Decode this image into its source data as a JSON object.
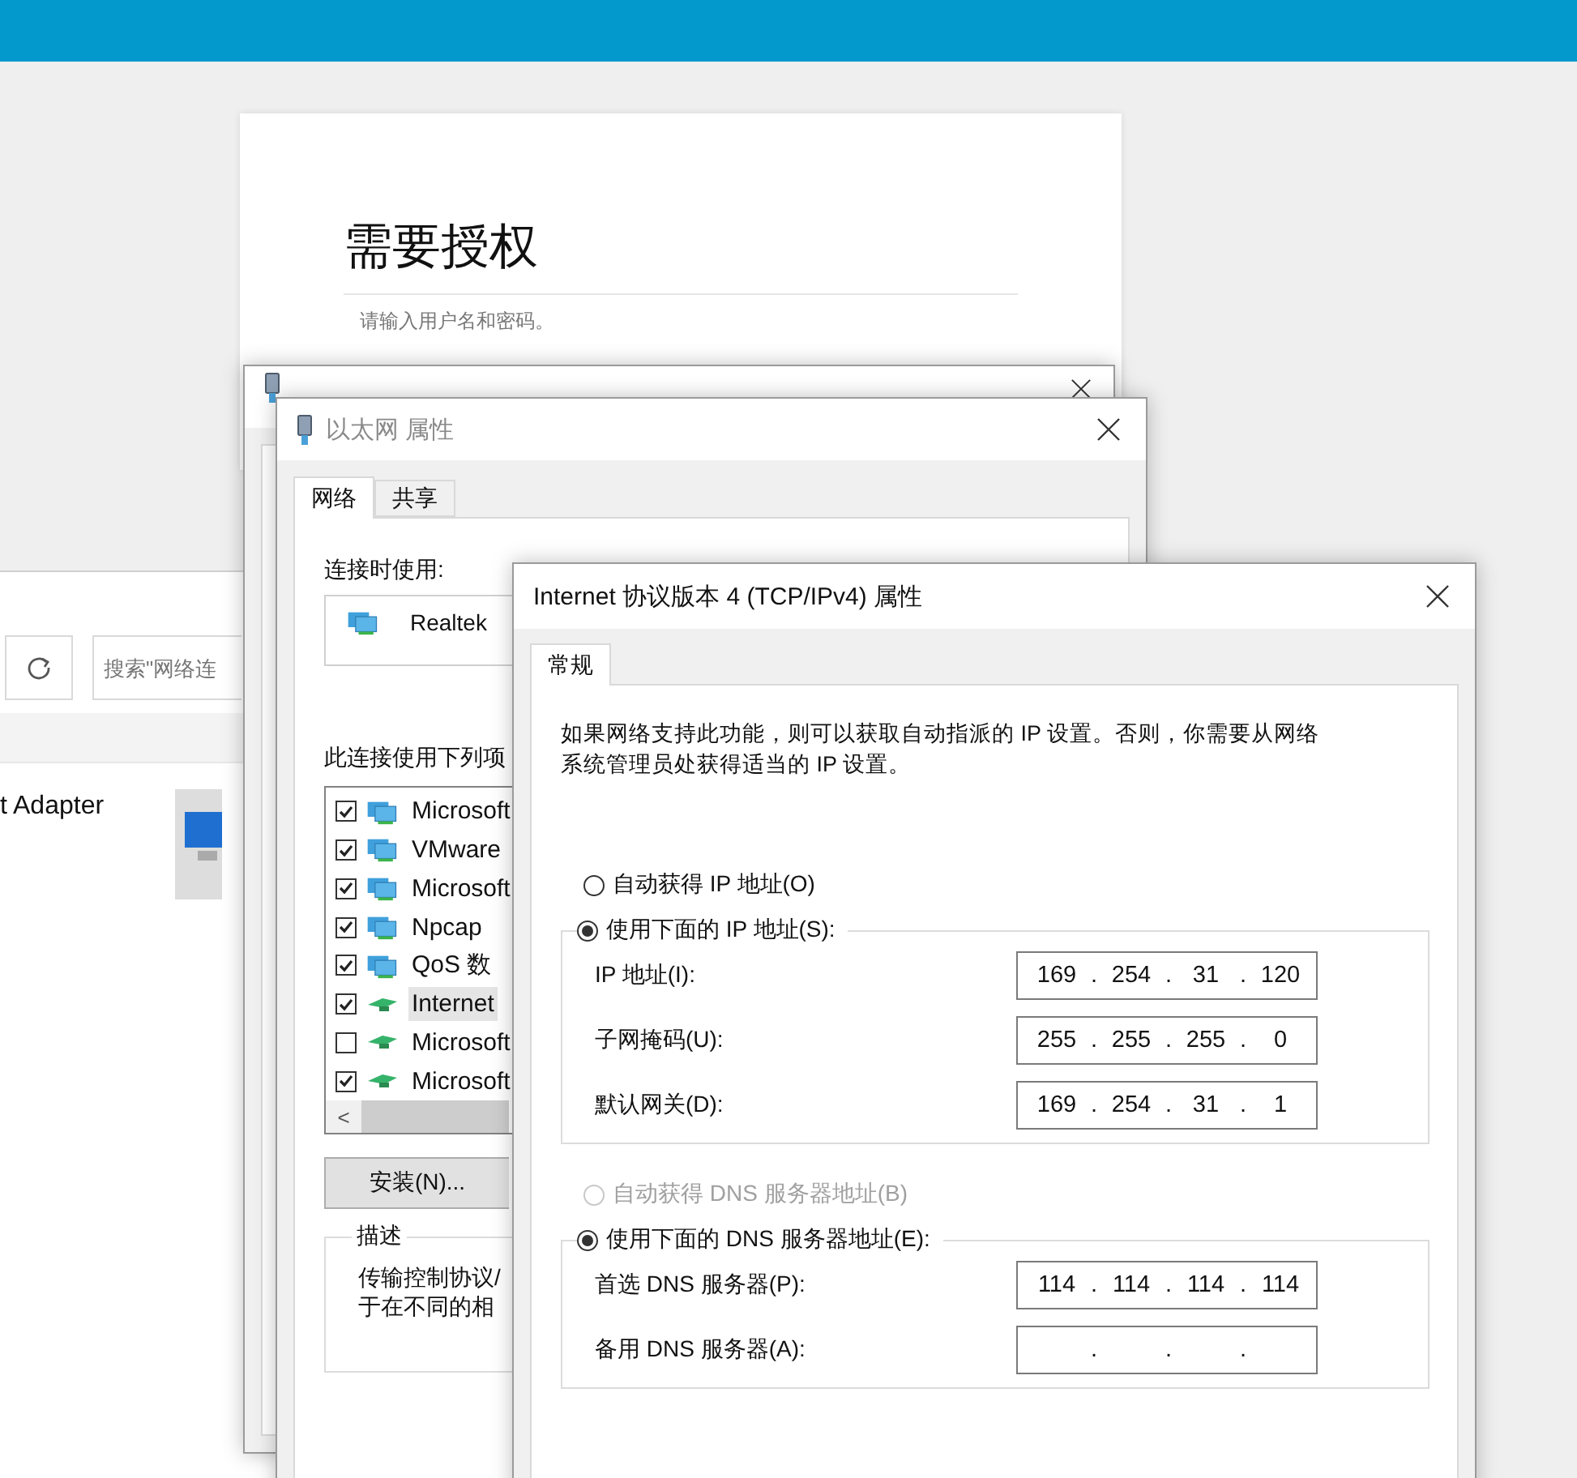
{
  "auth_card": {
    "title": "需要授权",
    "subtitle": "请输入用户名和密码。"
  },
  "explorer": {
    "search": {
      "placeholder": "搜索\"网络连"
    },
    "item": {
      "name": "t Adapter"
    }
  },
  "properties_window": {
    "title": "以太网 属性",
    "tabs": [
      {
        "label": "网络",
        "selected": true
      },
      {
        "label": "共享",
        "selected": false
      }
    ],
    "connect_using_label": "连接时使用:",
    "adapter": "Realtek",
    "items_label": "此连接使用下列项",
    "items": [
      {
        "label": "Microsoft",
        "checked": true,
        "kind": "service",
        "selected": false
      },
      {
        "label": "VMware",
        "checked": true,
        "kind": "service",
        "selected": false
      },
      {
        "label": "Microsoft",
        "checked": true,
        "kind": "service",
        "selected": false
      },
      {
        "label": "Npcap",
        "checked": true,
        "kind": "service",
        "selected": false
      },
      {
        "label": "QoS 数",
        "checked": true,
        "kind": "service",
        "selected": false
      },
      {
        "label": "Internet",
        "checked": true,
        "kind": "protocol",
        "selected": true
      },
      {
        "label": "Microsoft",
        "checked": false,
        "kind": "protocol",
        "selected": false
      },
      {
        "label": "Microsoft",
        "checked": true,
        "kind": "protocol",
        "selected": false
      }
    ],
    "scroll_left": "<",
    "install_button": "安装(N)...",
    "description": {
      "legend": "描述",
      "lines": [
        "传输控制协议/",
        "于在不同的相"
      ]
    }
  },
  "tcp_window": {
    "title": "Internet 协议版本 4 (TCP/IPv4) 属性",
    "tabs": [
      {
        "label": "常规",
        "selected": true
      }
    ],
    "intro": [
      "如果网络支持此功能，则可以获取自动指派的 IP 设置。否则，你需要从网络",
      "系统管理员处获得适当的 IP 设置。"
    ],
    "sections": [
      {
        "auto": {
          "label": "自动获得 IP 地址(O)",
          "selected": false,
          "disabled": false
        },
        "manual": {
          "label": "使用下面的 IP 地址(S):",
          "selected": true,
          "disabled": false
        },
        "fields": [
          {
            "label": "IP 地址(I):",
            "octets": [
              "169",
              "254",
              "31",
              "120"
            ],
            "dots": [
              ".",
              ".",
              "."
            ]
          },
          {
            "label": "子网掩码(U):",
            "octets": [
              "255",
              "255",
              "255",
              "0"
            ],
            "dots": [
              ".",
              ".",
              "."
            ]
          },
          {
            "label": "默认网关(D):",
            "octets": [
              "169",
              "254",
              "31",
              "1"
            ],
            "dots": [
              ".",
              ".",
              "."
            ]
          }
        ]
      },
      {
        "auto": {
          "label": "自动获得 DNS 服务器地址(B)",
          "selected": false,
          "disabled": true
        },
        "manual": {
          "label": "使用下面的 DNS 服务器地址(E):",
          "selected": true,
          "disabled": false
        },
        "fields": [
          {
            "label": "首选 DNS 服务器(P):",
            "octets": [
              "114",
              "114",
              "114",
              "114"
            ],
            "dots": [
              ".",
              ".",
              "."
            ]
          },
          {
            "label": "备用 DNS 服务器(A):",
            "dots": [
              ".",
              ".",
              "."
            ]
          }
        ]
      }
    ]
  }
}
